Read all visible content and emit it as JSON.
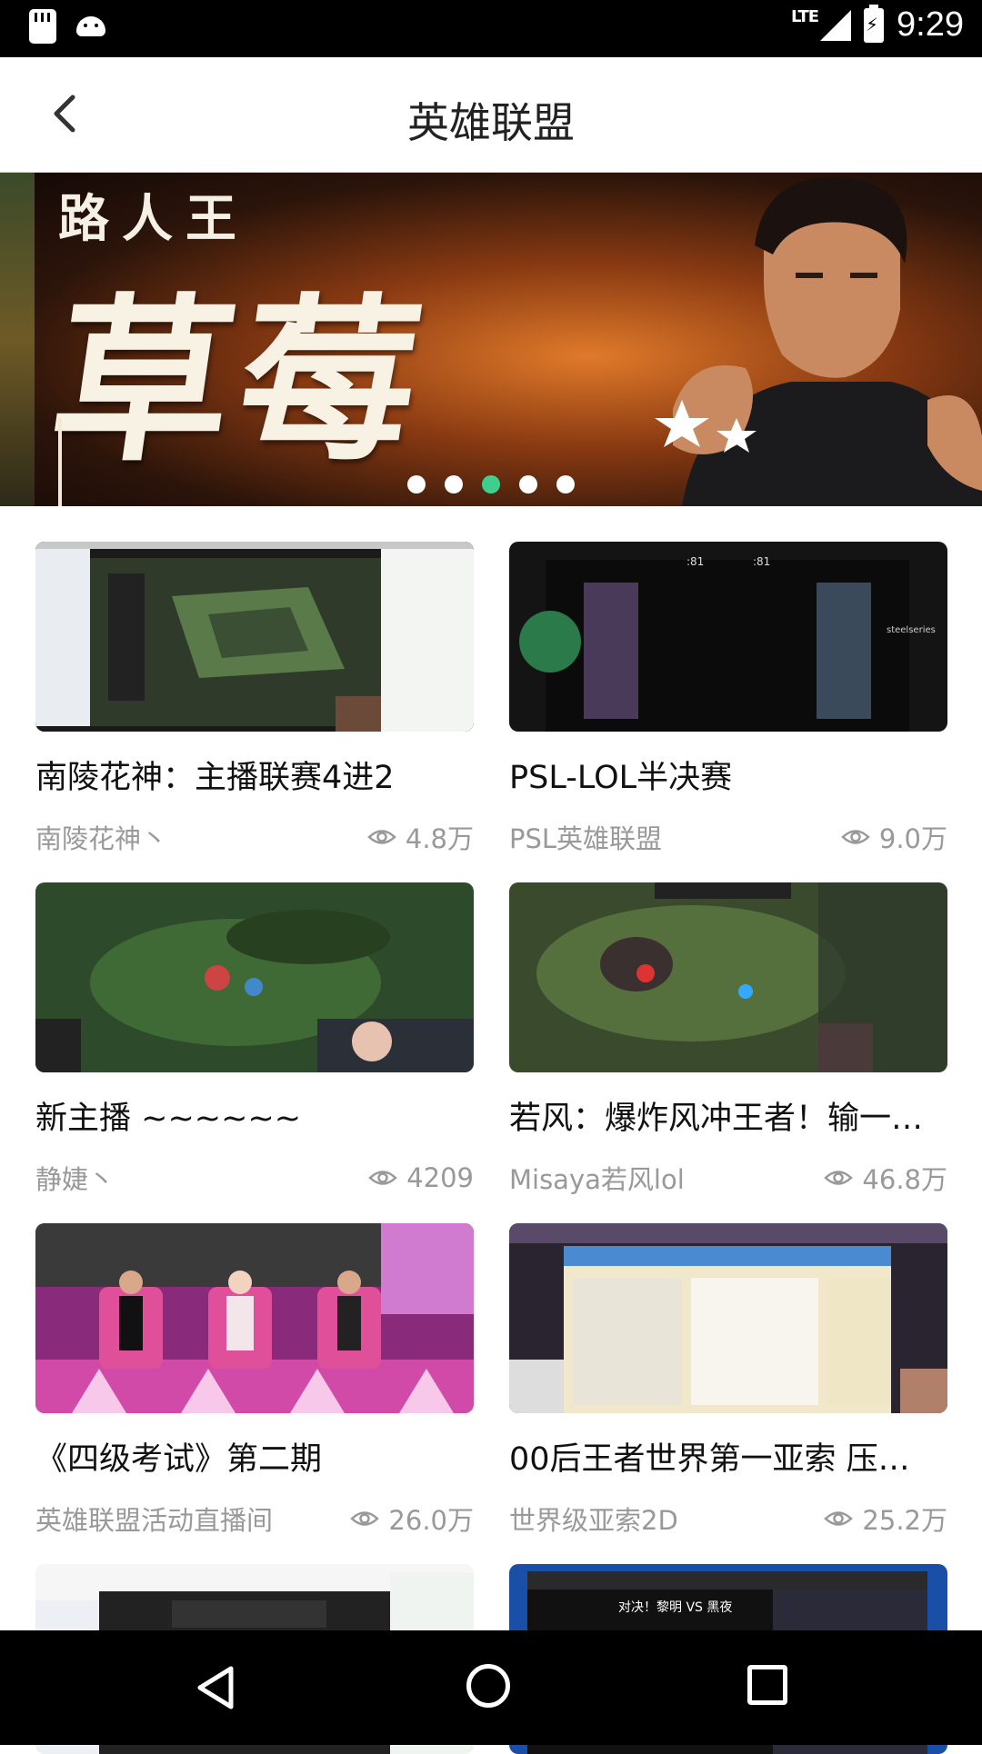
{
  "status_bar": {
    "network": "LTE",
    "time": "9:29"
  },
  "header": {
    "title": "英雄联盟"
  },
  "banner": {
    "overline": "路人王",
    "title": "草莓",
    "dot_count": 5,
    "active_index": 2
  },
  "cards": [
    {
      "title": "南陵花神：主播联赛4进2",
      "author": "南陵花神丶",
      "views": "4.8万",
      "theme": "desk"
    },
    {
      "title": "PSL-LOL半决赛",
      "author": "PSL英雄联盟",
      "views": "9.0万",
      "theme": "psl"
    },
    {
      "title": "新主播  ~~~~~~",
      "author": "静婕丶",
      "views": "4209",
      "theme": "map"
    },
    {
      "title": "若风：爆炸风冲王者！输一…",
      "author": "Misaya若风lol",
      "views": "46.8万",
      "theme": "map"
    },
    {
      "title": "《四级考试》第二期",
      "author": "英雄联盟活动直播间",
      "views": "26.0万",
      "theme": "studio"
    },
    {
      "title": "00后王者世界第一亚索 压…",
      "author": "世界级亚索2D",
      "views": "25.2万",
      "theme": "chat"
    },
    {
      "title": "",
      "author": "",
      "views": "",
      "theme": "desk2"
    },
    {
      "title": "",
      "author": "",
      "views": "",
      "theme": "blue"
    }
  ],
  "thumb_captions": {
    "psl_timer_left": ":81",
    "psl_timer_right": ":81",
    "psl_sponsor": "steelseries",
    "blue_banner": "对决！黎明 VS 黑夜"
  },
  "icons": {
    "back": "chevron-left-icon",
    "eye": "eye-icon",
    "nav_back": "triangle-back-icon",
    "nav_home": "circle-home-icon",
    "nav_recent": "square-recents-icon"
  }
}
